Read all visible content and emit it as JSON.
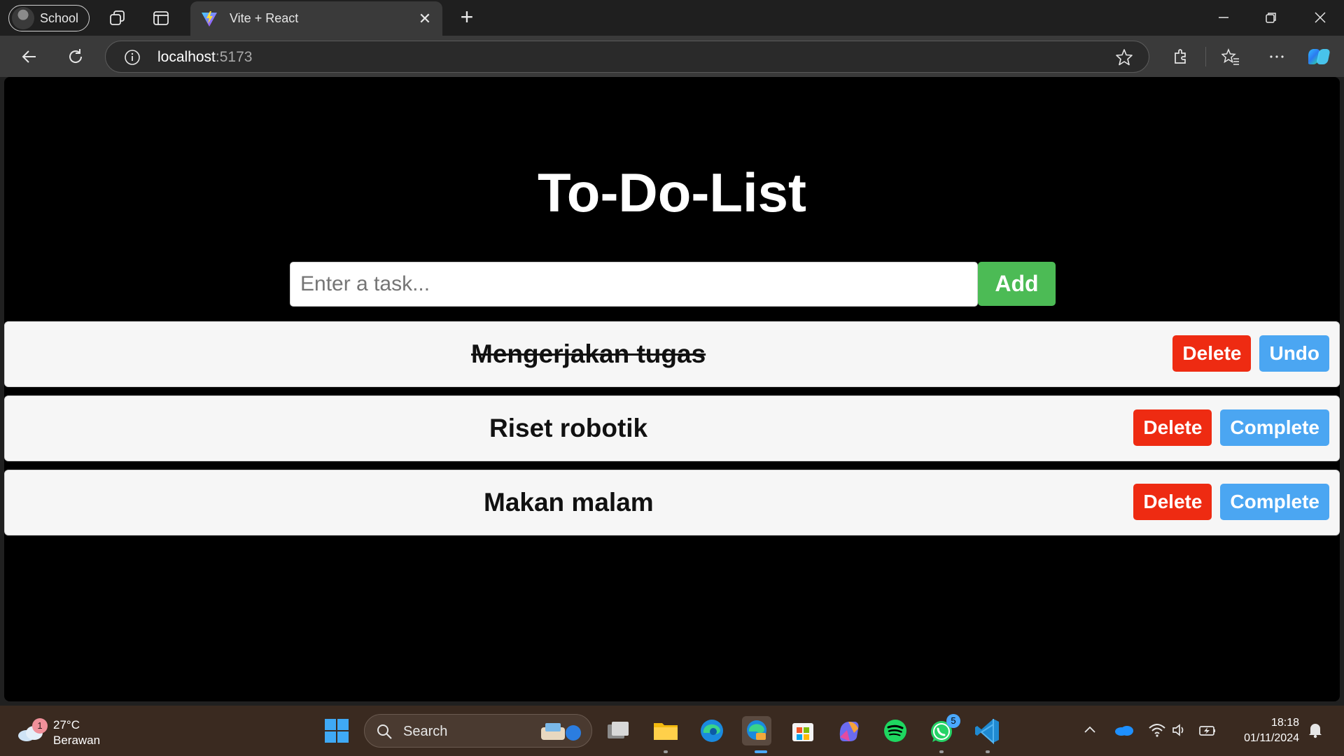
{
  "browser": {
    "profile_label": "School",
    "tab_title": "Vite + React",
    "url_host": "localhost",
    "url_port": ":5173"
  },
  "app": {
    "title": "To-Do-List",
    "input_placeholder": "Enter a task...",
    "input_value": "",
    "add_label": "Add",
    "tasks": [
      {
        "text": "Mengerjakan tugas",
        "completed": true,
        "delete_label": "Delete",
        "toggle_label": "Undo"
      },
      {
        "text": "Riset robotik",
        "completed": false,
        "delete_label": "Delete",
        "toggle_label": "Complete"
      },
      {
        "text": "Makan malam",
        "completed": false,
        "delete_label": "Delete",
        "toggle_label": "Complete"
      }
    ]
  },
  "taskbar": {
    "weather_temp": "27°C",
    "weather_condition": "Berawan",
    "weather_badge": "1",
    "search_label": "Search",
    "whatsapp_badge": "5",
    "time": "18:18",
    "date": "01/11/2024"
  },
  "colors": {
    "add_button": "#4cbb55",
    "delete_button": "#ee2b12",
    "toggle_button": "#4ba6f2",
    "page_background": "#000000"
  }
}
